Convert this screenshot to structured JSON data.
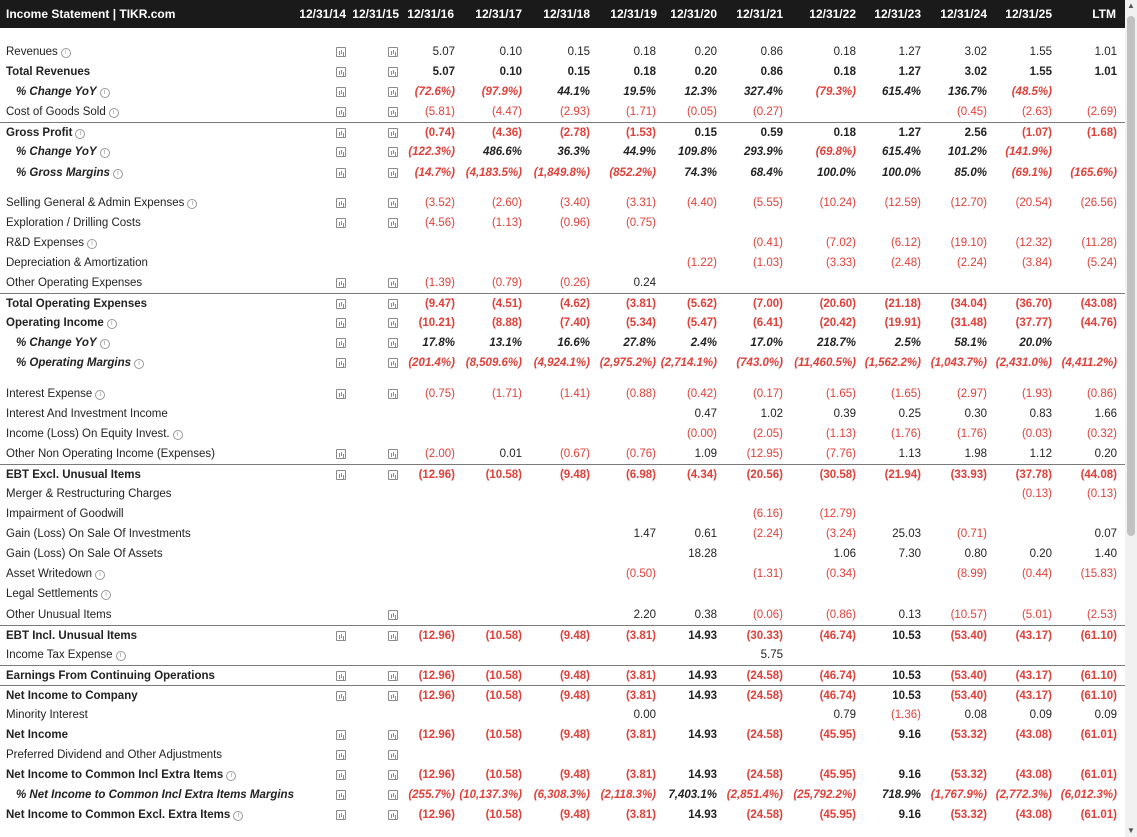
{
  "header": {
    "title": "Income Statement | TIKR.com",
    "columns": [
      "12/31/14",
      "12/31/15",
      "12/31/16",
      "12/31/17",
      "12/31/18",
      "12/31/19",
      "12/31/20",
      "12/31/21",
      "12/31/22",
      "12/31/23",
      "12/31/24",
      "12/31/25",
      "LTM"
    ]
  },
  "rows": [
    {
      "label": "Revenues",
      "style": "",
      "info": true,
      "c14": true,
      "c15": true,
      "values": [
        "5.07",
        "0.10",
        "0.15",
        "0.18",
        "0.20",
        "0.86",
        "0.18",
        "1.27",
        "3.02",
        "1.55",
        "1.01"
      ]
    },
    {
      "label": "Total Revenues",
      "style": "bold",
      "info": false,
      "c14": true,
      "c15": true,
      "values": [
        "5.07",
        "0.10",
        "0.15",
        "0.18",
        "0.20",
        "0.86",
        "0.18",
        "1.27",
        "3.02",
        "1.55",
        "1.01"
      ]
    },
    {
      "label": "% Change YoY",
      "style": "italic",
      "info": true,
      "c14": true,
      "c15": true,
      "values": [
        "(72.6%)",
        "(97.9%)",
        "44.1%",
        "19.5%",
        "12.3%",
        "327.4%",
        "(79.3%)",
        "615.4%",
        "136.7%",
        "(48.5%)",
        ""
      ]
    },
    {
      "label": "Cost of Goods Sold",
      "style": "",
      "info": true,
      "c14": true,
      "c15": true,
      "values": [
        "(5.81)",
        "(4.47)",
        "(2.93)",
        "(1.71)",
        "(0.05)",
        "(0.27)",
        "",
        "",
        "(0.45)",
        "(2.63)",
        "(2.69)"
      ]
    },
    {
      "label": "Gross Profit",
      "style": "bold topline",
      "info": true,
      "c14": true,
      "c15": true,
      "values": [
        "(0.74)",
        "(4.36)",
        "(2.78)",
        "(1.53)",
        "0.15",
        "0.59",
        "0.18",
        "1.27",
        "2.56",
        "(1.07)",
        "(1.68)"
      ]
    },
    {
      "label": "% Change YoY",
      "style": "italic",
      "info": true,
      "c14": true,
      "c15": true,
      "values": [
        "(122.3%)",
        "486.6%",
        "36.3%",
        "44.9%",
        "109.8%",
        "293.9%",
        "(69.8%)",
        "615.4%",
        "101.2%",
        "(141.9%)",
        ""
      ]
    },
    {
      "label": "% Gross Margins",
      "style": "italic",
      "info": true,
      "c14": true,
      "c15": true,
      "values": [
        "(14.7%)",
        "(4,183.5%)",
        "(1,849.8%)",
        "(852.2%)",
        "74.3%",
        "68.4%",
        "100.0%",
        "100.0%",
        "85.0%",
        "(69.1%)",
        "(165.6%)"
      ]
    },
    {
      "sep": true
    },
    {
      "label": "Selling General & Admin Expenses",
      "style": "",
      "info": true,
      "c14": true,
      "c15": true,
      "values": [
        "(3.52)",
        "(2.60)",
        "(3.40)",
        "(3.31)",
        "(4.40)",
        "(5.55)",
        "(10.24)",
        "(12.59)",
        "(12.70)",
        "(20.54)",
        "(26.56)"
      ]
    },
    {
      "label": "Exploration / Drilling Costs",
      "style": "",
      "info": false,
      "c14": true,
      "c15": true,
      "values": [
        "(4.56)",
        "(1.13)",
        "(0.96)",
        "(0.75)",
        "",
        "",
        "",
        "",
        "",
        "",
        ""
      ]
    },
    {
      "label": "R&D Expenses",
      "style": "",
      "info": true,
      "c14": false,
      "c15": false,
      "values": [
        "",
        "",
        "",
        "",
        "",
        "(0.41)",
        "(7.02)",
        "(6.12)",
        "(19.10)",
        "(12.32)",
        "(11.28)"
      ]
    },
    {
      "label": "Depreciation & Amortization",
      "style": "",
      "info": false,
      "c14": false,
      "c15": false,
      "values": [
        "",
        "",
        "",
        "",
        "(1.22)",
        "(1.03)",
        "(3.33)",
        "(2.48)",
        "(2.24)",
        "(3.84)",
        "(5.24)"
      ]
    },
    {
      "label": "Other Operating Expenses",
      "style": "",
      "info": false,
      "c14": true,
      "c15": true,
      "values": [
        "(1.39)",
        "(0.79)",
        "(0.26)",
        "0.24",
        "",
        "",
        "",
        "",
        "",
        "",
        ""
      ]
    },
    {
      "label": "Total Operating Expenses",
      "style": "bold topline",
      "info": false,
      "c14": true,
      "c15": true,
      "values": [
        "(9.47)",
        "(4.51)",
        "(4.62)",
        "(3.81)",
        "(5.62)",
        "(7.00)",
        "(20.60)",
        "(21.18)",
        "(34.04)",
        "(36.70)",
        "(43.08)"
      ]
    },
    {
      "label": "Operating Income",
      "style": "bold",
      "info": true,
      "c14": true,
      "c15": true,
      "values": [
        "(10.21)",
        "(8.88)",
        "(7.40)",
        "(5.34)",
        "(5.47)",
        "(6.41)",
        "(20.42)",
        "(19.91)",
        "(31.48)",
        "(37.77)",
        "(44.76)"
      ]
    },
    {
      "label": "% Change YoY",
      "style": "italic",
      "info": true,
      "c14": true,
      "c15": true,
      "values": [
        "17.8%",
        "13.1%",
        "16.6%",
        "27.8%",
        "2.4%",
        "17.0%",
        "218.7%",
        "2.5%",
        "58.1%",
        "20.0%",
        ""
      ]
    },
    {
      "label": "% Operating Margins",
      "style": "italic",
      "info": true,
      "c14": true,
      "c15": true,
      "values": [
        "(201.4%)",
        "(8,509.6%)",
        "(4,924.1%)",
        "(2,975.2%)",
        "(2,714.1%)",
        "(743.0%)",
        "(11,460.5%)",
        "(1,562.2%)",
        "(1,043.7%)",
        "(2,431.0%)",
        "(4,411.2%)"
      ]
    },
    {
      "sep": true
    },
    {
      "label": "Interest Expense",
      "style": "",
      "info": true,
      "c14": true,
      "c15": true,
      "values": [
        "(0.75)",
        "(1.71)",
        "(1.41)",
        "(0.88)",
        "(0.42)",
        "(0.17)",
        "(1.65)",
        "(1.65)",
        "(2.97)",
        "(1.93)",
        "(0.86)"
      ]
    },
    {
      "label": "Interest And Investment Income",
      "style": "",
      "info": false,
      "c14": false,
      "c15": false,
      "values": [
        "",
        "",
        "",
        "",
        "0.47",
        "1.02",
        "0.39",
        "0.25",
        "0.30",
        "0.83",
        "1.66"
      ]
    },
    {
      "label": "Income (Loss) On Equity Invest.",
      "style": "",
      "info": true,
      "c14": false,
      "c15": false,
      "values": [
        "",
        "",
        "",
        "",
        "(0.00)",
        "(2.05)",
        "(1.13)",
        "(1.76)",
        "(1.76)",
        "(0.03)",
        "(0.32)"
      ]
    },
    {
      "label": "Other Non Operating Income (Expenses)",
      "style": "",
      "info": false,
      "c14": true,
      "c15": true,
      "values": [
        "(2.00)",
        "0.01",
        "(0.67)",
        "(0.76)",
        "1.09",
        "(12.95)",
        "(7.76)",
        "1.13",
        "1.98",
        "1.12",
        "0.20"
      ]
    },
    {
      "label": "EBT Excl. Unusual Items",
      "style": "bold topline",
      "info": false,
      "c14": true,
      "c15": true,
      "values": [
        "(12.96)",
        "(10.58)",
        "(9.48)",
        "(6.98)",
        "(4.34)",
        "(20.56)",
        "(30.58)",
        "(21.94)",
        "(33.93)",
        "(37.78)",
        "(44.08)"
      ]
    },
    {
      "label": "Merger & Restructuring Charges",
      "style": "",
      "info": false,
      "c14": false,
      "c15": false,
      "values": [
        "",
        "",
        "",
        "",
        "",
        "",
        "",
        "",
        "",
        "(0.13)",
        "(0.13)"
      ]
    },
    {
      "label": "Impairment of Goodwill",
      "style": "",
      "info": false,
      "c14": false,
      "c15": false,
      "values": [
        "",
        "",
        "",
        "",
        "",
        "(6.16)",
        "(12.79)",
        "",
        "",
        "",
        ""
      ]
    },
    {
      "label": "Gain (Loss) On Sale Of Investments",
      "style": "",
      "info": false,
      "c14": false,
      "c15": false,
      "values": [
        "",
        "",
        "",
        "1.47",
        "0.61",
        "(2.24)",
        "(3.24)",
        "25.03",
        "(0.71)",
        "",
        "0.07"
      ]
    },
    {
      "label": "Gain (Loss) On Sale Of Assets",
      "style": "",
      "info": false,
      "c14": false,
      "c15": false,
      "values": [
        "",
        "",
        "",
        "",
        "18.28",
        "",
        "1.06",
        "7.30",
        "0.80",
        "0.20",
        "1.40"
      ]
    },
    {
      "label": "Asset Writedown",
      "style": "",
      "info": true,
      "c14": false,
      "c15": false,
      "values": [
        "",
        "",
        "",
        "(0.50)",
        "",
        "(1.31)",
        "(0.34)",
        "",
        "(8.99)",
        "(0.44)",
        "(15.83)"
      ]
    },
    {
      "label": "Legal Settlements",
      "style": "",
      "info": true,
      "c14": false,
      "c15": false,
      "values": [
        "",
        "",
        "",
        "",
        "",
        "",
        "",
        "",
        "",
        "",
        ""
      ]
    },
    {
      "label": "Other Unusual Items",
      "style": "",
      "info": false,
      "c14": false,
      "c15": true,
      "values": [
        "",
        "",
        "",
        "2.20",
        "0.38",
        "(0.06)",
        "(0.86)",
        "0.13",
        "(10.57)",
        "(5.01)",
        "(2.53)"
      ]
    },
    {
      "label": "EBT Incl. Unusual Items",
      "style": "bold topline",
      "info": false,
      "c14": true,
      "c15": true,
      "values": [
        "(12.96)",
        "(10.58)",
        "(9.48)",
        "(3.81)",
        "14.93",
        "(30.33)",
        "(46.74)",
        "10.53",
        "(53.40)",
        "(43.17)",
        "(61.10)"
      ]
    },
    {
      "label": "Income Tax Expense",
      "style": "",
      "info": true,
      "c14": false,
      "c15": false,
      "values": [
        "",
        "",
        "",
        "",
        "",
        "5.75",
        "",
        "",
        "",
        "",
        ""
      ]
    },
    {
      "label": "Earnings From Continuing Operations",
      "style": "bold topline",
      "info": false,
      "c14": true,
      "c15": true,
      "values": [
        "(12.96)",
        "(10.58)",
        "(9.48)",
        "(3.81)",
        "14.93",
        "(24.58)",
        "(46.74)",
        "10.53",
        "(53.40)",
        "(43.17)",
        "(61.10)"
      ]
    },
    {
      "label": "Net Income to Company",
      "style": "bold topline",
      "info": false,
      "c14": true,
      "c15": true,
      "values": [
        "(12.96)",
        "(10.58)",
        "(9.48)",
        "(3.81)",
        "14.93",
        "(24.58)",
        "(46.74)",
        "10.53",
        "(53.40)",
        "(43.17)",
        "(61.10)"
      ]
    },
    {
      "label": "Minority Interest",
      "style": "",
      "info": false,
      "c14": false,
      "c15": false,
      "values": [
        "",
        "",
        "",
        "0.00",
        "",
        "",
        "0.79",
        "(1.36)",
        "0.08",
        "0.09",
        "0.09"
      ]
    },
    {
      "label": "Net Income",
      "style": "bold",
      "info": false,
      "c14": true,
      "c15": true,
      "values": [
        "(12.96)",
        "(10.58)",
        "(9.48)",
        "(3.81)",
        "14.93",
        "(24.58)",
        "(45.95)",
        "9.16",
        "(53.32)",
        "(43.08)",
        "(61.01)"
      ]
    },
    {
      "label": "Preferred Dividend and Other Adjustments",
      "style": "",
      "info": false,
      "c14": true,
      "c15": true,
      "values": [
        "",
        "",
        "",
        "",
        "",
        "",
        "",
        "",
        "",
        "",
        ""
      ]
    },
    {
      "label": "Net Income to Common Incl Extra Items",
      "style": "bold",
      "info": true,
      "c14": true,
      "c15": true,
      "values": [
        "(12.96)",
        "(10.58)",
        "(9.48)",
        "(3.81)",
        "14.93",
        "(24.58)",
        "(45.95)",
        "9.16",
        "(53.32)",
        "(43.08)",
        "(61.01)"
      ]
    },
    {
      "label": "% Net Income to Common Incl Extra Items Margins",
      "style": "italic",
      "info": false,
      "c14": true,
      "c15": true,
      "values": [
        "(255.7%)",
        "(10,137.3%)",
        "(6,308.3%)",
        "(2,118.3%)",
        "7,403.1%",
        "(2,851.4%)",
        "(25,792.2%)",
        "718.9%",
        "(1,767.9%)",
        "(2,772.3%)",
        "(6,012.3%)"
      ]
    },
    {
      "label": "Net Income to Common Excl. Extra Items",
      "style": "bold",
      "info": true,
      "c14": true,
      "c15": true,
      "values": [
        "(12.96)",
        "(10.58)",
        "(9.48)",
        "(3.81)",
        "14.93",
        "(24.58)",
        "(45.95)",
        "9.16",
        "(53.32)",
        "(43.08)",
        "(61.01)"
      ]
    }
  ]
}
